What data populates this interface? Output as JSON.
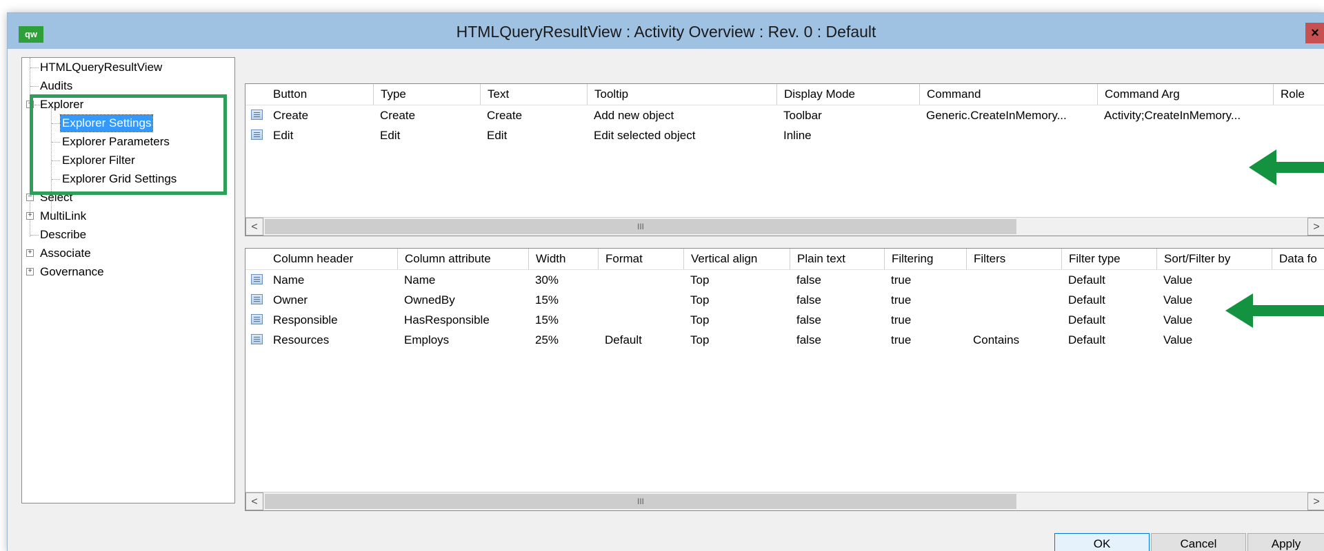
{
  "window": {
    "title": "HTMLQueryResultView : Activity Overview : Rev. 0  : Default",
    "app_icon_text": "qw",
    "close_glyph": "×"
  },
  "tree": {
    "items": [
      {
        "label": "HTMLQueryResultView",
        "expander": ""
      },
      {
        "label": "Audits",
        "expander": ""
      },
      {
        "label": "Explorer",
        "expander": "−"
      },
      {
        "label": "Explorer Settings",
        "expander": "",
        "selected": true
      },
      {
        "label": "Explorer Parameters",
        "expander": ""
      },
      {
        "label": "Explorer Filter",
        "expander": ""
      },
      {
        "label": "Explorer Grid Settings",
        "expander": ""
      },
      {
        "label": "Select",
        "expander": "−"
      },
      {
        "label": "MultiLink",
        "expander": "+"
      },
      {
        "label": "Describe",
        "expander": ""
      },
      {
        "label": "Associate",
        "expander": "+"
      },
      {
        "label": "Governance",
        "expander": "+"
      }
    ]
  },
  "buttons_grid": {
    "columns": [
      "Button",
      "Type",
      "Text",
      "Tooltip",
      "Display Mode",
      "Command",
      "Command Arg",
      "Role"
    ],
    "rows": [
      [
        "Create",
        "Create",
        "Create",
        "Add new object",
        "Toolbar",
        "Generic.CreateInMemory...",
        "Activity;CreateInMemory...",
        ""
      ],
      [
        "Edit",
        "Edit",
        "Edit",
        "Edit selected object",
        "Inline",
        "",
        "",
        ""
      ]
    ],
    "scroll_left": "<",
    "scroll_right": ">",
    "thumb_grip": "III"
  },
  "columns_grid": {
    "columns": [
      "Column header",
      "Column attribute",
      "Width",
      "Format",
      "Vertical align",
      "Plain text",
      "Filtering",
      "Filters",
      "Filter type",
      "Sort/Filter by",
      "Data fo"
    ],
    "rows": [
      [
        "Name",
        "Name",
        "30%",
        "",
        "Top",
        "false",
        "true",
        "",
        "Default",
        "Value",
        ""
      ],
      [
        "Owner",
        "OwnedBy",
        "15%",
        "",
        "Top",
        "false",
        "true",
        "",
        "Default",
        "Value",
        ""
      ],
      [
        "Responsible",
        "HasResponsible",
        "15%",
        "",
        "Top",
        "false",
        "true",
        "",
        "Default",
        "Value",
        ""
      ],
      [
        "Resources",
        "Employs",
        "25%",
        "Default",
        "Top",
        "false",
        "true",
        "Contains",
        "Default",
        "Value",
        ""
      ]
    ],
    "scroll_left": "<",
    "scroll_right": ">",
    "thumb_grip": "III"
  },
  "footer": {
    "ok": "OK",
    "cancel": "Cancel",
    "apply": "Apply"
  },
  "colors": {
    "titlebar": "#9fc2e3",
    "selection": "#3399ff",
    "highlight_box": "#2e9f58",
    "arrow": "#13923f",
    "close": "#c75050"
  }
}
